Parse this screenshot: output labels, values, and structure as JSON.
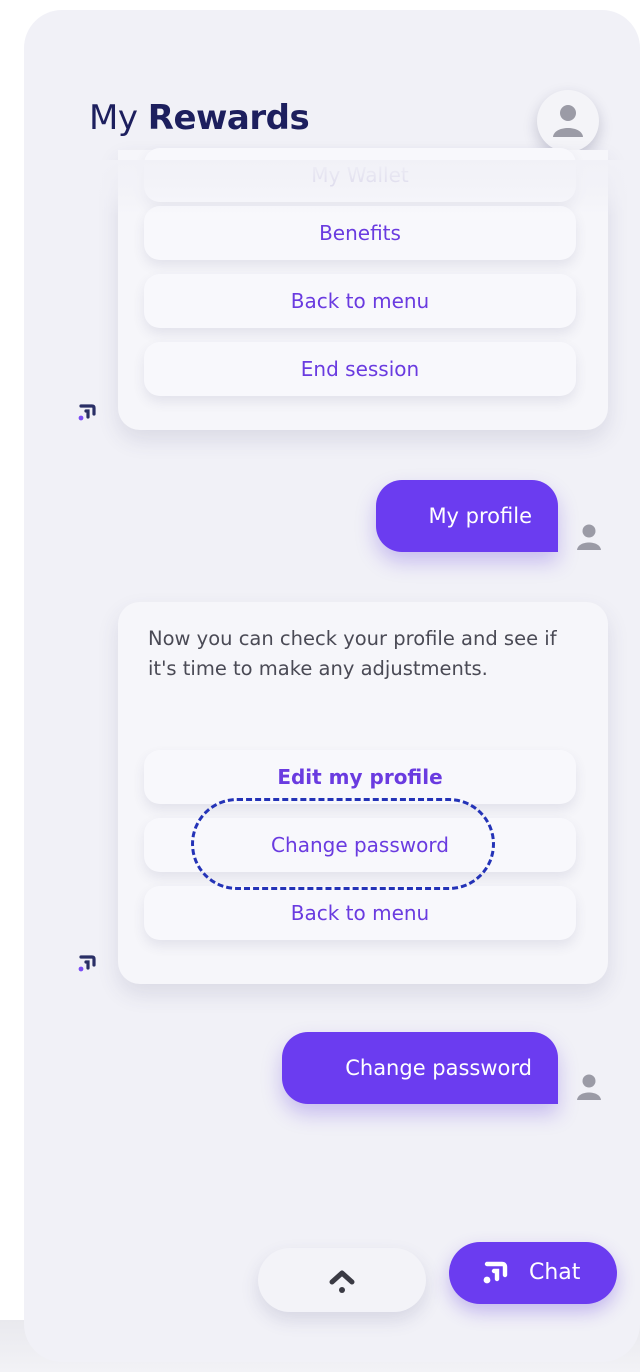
{
  "header": {
    "title_light": "My",
    "title_bold": "Rewards"
  },
  "card1": {
    "options": [
      {
        "label": "My Wallet"
      },
      {
        "label": "Benefits"
      },
      {
        "label": "Back to menu"
      },
      {
        "label": "End session"
      }
    ]
  },
  "messages": {
    "user1": "My profile",
    "bot2_text": "Now you can check your profile and see if it's time to make any adjustments.",
    "user2": "Change password"
  },
  "card2": {
    "options": [
      {
        "label": "Edit my profile"
      },
      {
        "label": "Change password"
      },
      {
        "label": "Back to menu"
      }
    ]
  },
  "footer": {
    "chat_label": "Chat"
  },
  "colors": {
    "accent": "#6b3cf0",
    "title": "#1d1f5e",
    "highlight": "#2433b7",
    "background": "#f1f1f7"
  },
  "icons": {
    "avatar": "user-avatar-icon",
    "bot": "bot-logo-icon",
    "scroll_up": "chevron-up-icon",
    "chat": "chat-logo-icon"
  }
}
